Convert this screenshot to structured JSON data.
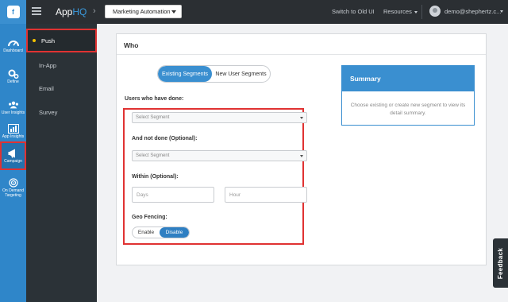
{
  "brand": {
    "app": "App",
    "hq": "HQ"
  },
  "header": {
    "app_selector": "Marketing Automation",
    "switch_link": "Switch to Old UI",
    "resources": "Resources",
    "user_email": "demo@shephertz.c..."
  },
  "rail": {
    "items": [
      {
        "label": "Dashboard",
        "icon": "gauge-icon"
      },
      {
        "label": "Define",
        "icon": "gears-icon"
      },
      {
        "label": "User Insights",
        "icon": "users-icon"
      },
      {
        "label": "App Insights",
        "icon": "chart-icon"
      },
      {
        "label": "Campaign",
        "icon": "megaphone-icon",
        "active": true
      },
      {
        "label": "On Demand Targeting",
        "icon": "target-icon"
      }
    ]
  },
  "subnav": {
    "items": [
      {
        "label": "Push",
        "active": true
      },
      {
        "label": "In-App"
      },
      {
        "label": "Email"
      },
      {
        "label": "Survey"
      }
    ]
  },
  "card": {
    "title": "Who",
    "segment_tabs": {
      "existing": "Existing Segments",
      "new": "New User Segments"
    },
    "users_done_label": "Users who have done:",
    "users_done_placeholder": "Select Segment",
    "not_done_label": "And not done (Optional):",
    "not_done_placeholder": "Select Segment",
    "within_label": "Within (Optional):",
    "days_placeholder": "Days",
    "hour_placeholder": "Hour",
    "geo_label": "Geo Fencing:",
    "geo_enable": "Enable",
    "geo_disable": "Disable"
  },
  "summary": {
    "title": "Summary",
    "body": "Choose existing or create new segment to view its detail summary."
  },
  "feedback": "Feedback",
  "colors": {
    "accent": "#3a8fd0",
    "highlight": "#e03232",
    "sidebar": "#2b3237"
  }
}
